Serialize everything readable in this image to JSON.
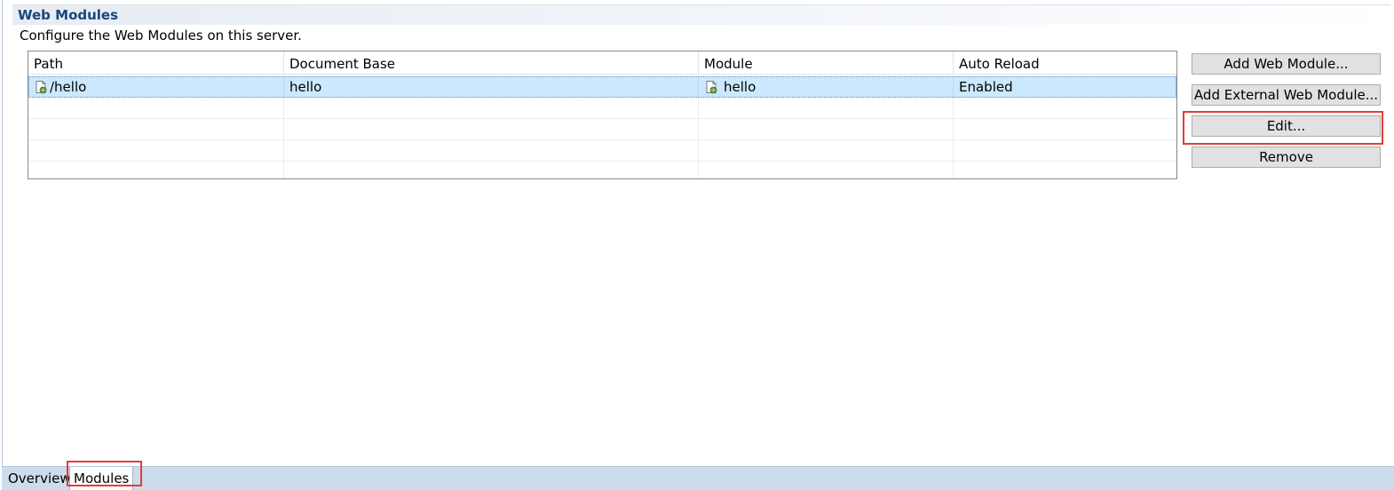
{
  "section": {
    "title": "Web Modules",
    "description": "Configure the Web Modules on this server."
  },
  "table": {
    "columns": [
      "Path",
      "Document Base",
      "Module",
      "Auto Reload"
    ],
    "rows": [
      {
        "path": "/hello",
        "document_base": "hello",
        "module": "hello",
        "auto_reload": "Enabled",
        "selected": true
      }
    ],
    "empty_rows": 4
  },
  "buttons": {
    "add_web_module": "Add Web Module...",
    "add_external_web_module": "Add External Web Module...",
    "edit": "Edit...",
    "remove": "Remove"
  },
  "tabs": [
    {
      "label": "Overview",
      "active": false
    },
    {
      "label": "Modules",
      "active": true
    }
  ],
  "icons": {
    "module": "web-module-icon"
  },
  "colors": {
    "title": "#19467a",
    "selection": "#cce8ff",
    "highlight": "#e53a3a",
    "tabbar": "#cddcec"
  }
}
